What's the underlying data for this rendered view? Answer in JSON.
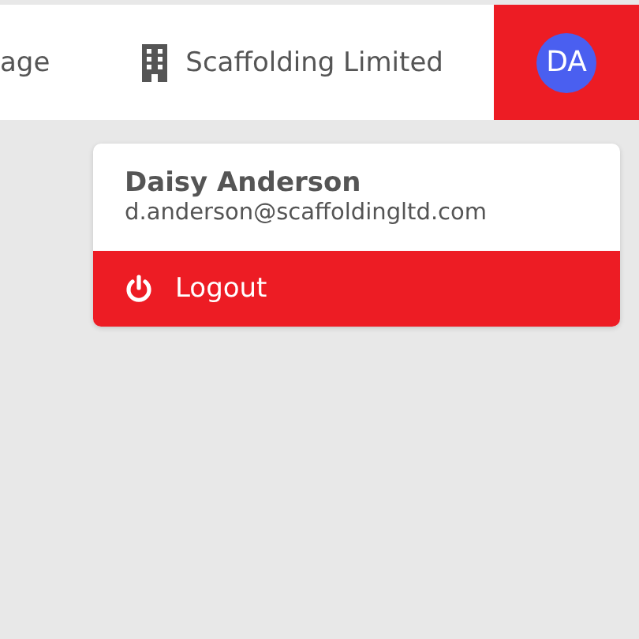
{
  "nav": {
    "items": [
      {
        "label": "age"
      }
    ],
    "company": {
      "name": "Scaffolding Limited"
    },
    "avatar": {
      "initials": "DA"
    }
  },
  "user_menu": {
    "name": "Daisy Anderson",
    "email": "d.anderson@scaffoldingltd.com",
    "logout": {
      "label": "Logout"
    }
  }
}
